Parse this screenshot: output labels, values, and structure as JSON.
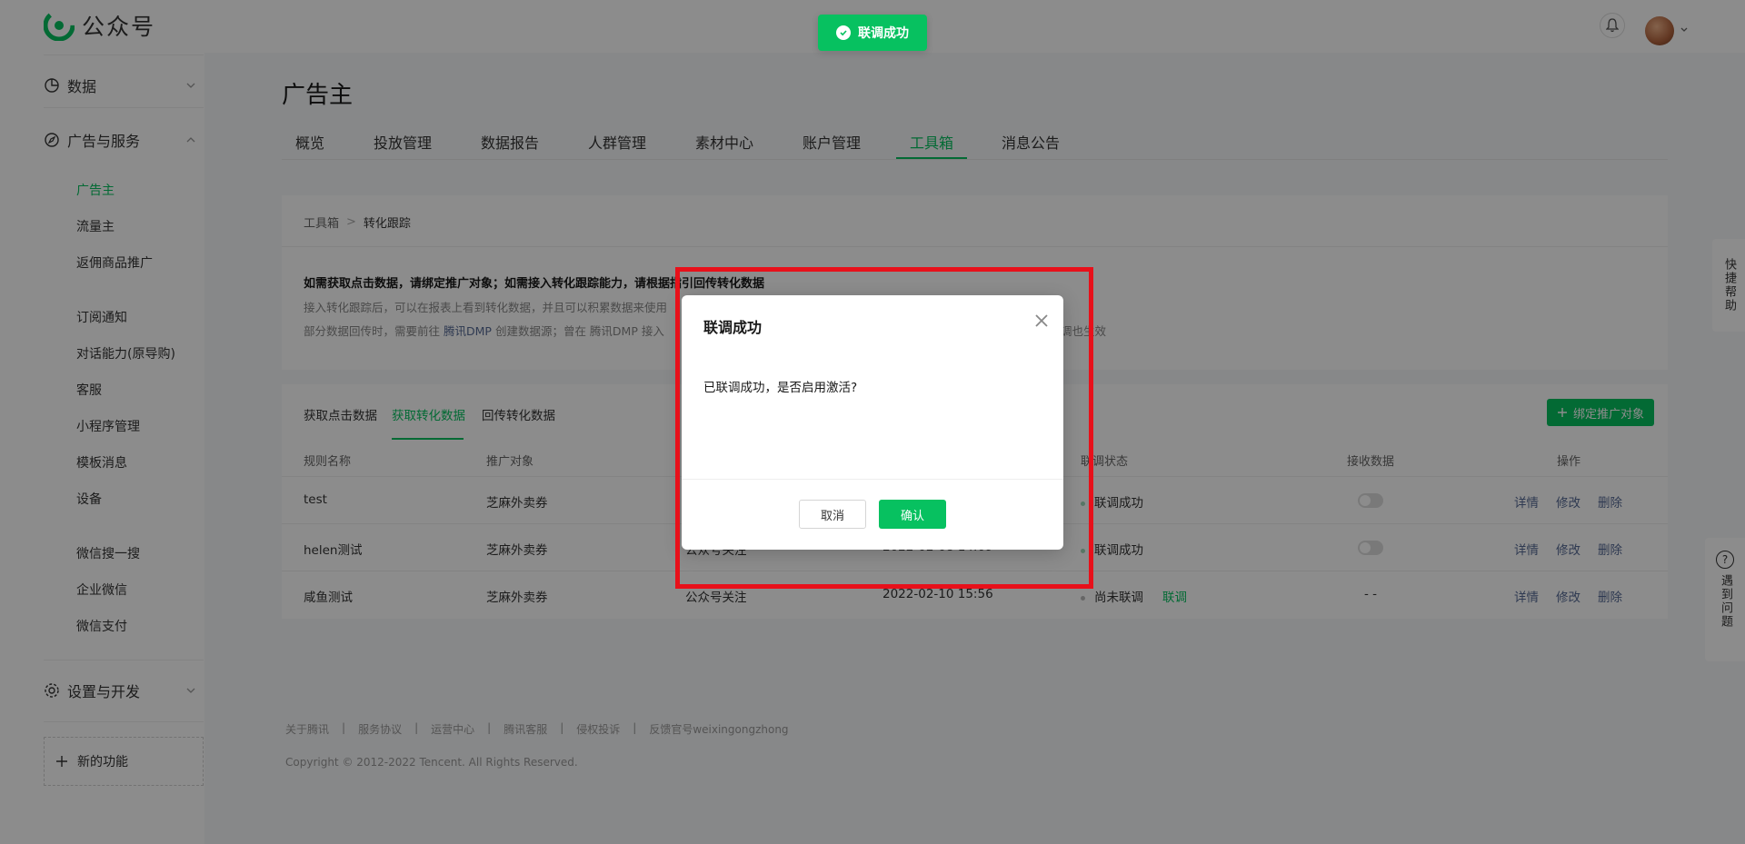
{
  "app": {
    "name": "公众号"
  },
  "sidebar": {
    "groups": [
      {
        "label": "数据"
      },
      {
        "label": "广告与服务"
      },
      {
        "label": "设置与开发"
      }
    ],
    "items": [
      {
        "label": "广告主",
        "active": true
      },
      {
        "label": "流量主"
      },
      {
        "label": "返佣商品推广"
      },
      {
        "label": "订阅通知"
      },
      {
        "label": "对话能力(原导购)"
      },
      {
        "label": "客服"
      },
      {
        "label": "小程序管理"
      },
      {
        "label": "模板消息"
      },
      {
        "label": "设备"
      },
      {
        "label": "微信搜一搜"
      },
      {
        "label": "企业微信"
      },
      {
        "label": "微信支付"
      }
    ],
    "new_func": "新的功能"
  },
  "page": {
    "title": "广告主"
  },
  "tabs": [
    {
      "label": "概览"
    },
    {
      "label": "投放管理"
    },
    {
      "label": "数据报告"
    },
    {
      "label": "人群管理"
    },
    {
      "label": "素材中心"
    },
    {
      "label": "账户管理"
    },
    {
      "label": "工具箱",
      "active": true
    },
    {
      "label": "消息公告"
    }
  ],
  "breadcrumb": {
    "parent": "工具箱",
    "sep": ">",
    "current": "转化跟踪"
  },
  "notice": {
    "title": "如需获取点击数据，请绑定推广对象；如需接入转化跟踪能力，请根据指引回传转化数据",
    "line1": "接入转化跟踪后，可以在报表上看到转化数据，并且可以积累数据来使用",
    "line2_a": "部分数据回传时，需要前往",
    "line2_link": "腾讯DMP",
    "line2_b": "创建数据源；曾在 腾讯DMP 接入",
    "line2_tail": "调也生效"
  },
  "subtabs": [
    {
      "label": "获取点击数据"
    },
    {
      "label": "获取转化数据",
      "active": true
    },
    {
      "label": "回传转化数据"
    }
  ],
  "bind_button": "绑定推广对象",
  "table": {
    "headers": [
      "规则名称",
      "推广对象",
      "联调状态",
      "接收数据",
      "操作"
    ],
    "rows": [
      {
        "name": "test",
        "target": "芝麻外卖券",
        "type": "",
        "time": "",
        "status": "联调成功",
        "receive": "toggle"
      },
      {
        "name": "helen测试",
        "target": "芝麻外卖券",
        "type": "公众号关注",
        "time": "2022-02-08 14:09",
        "status": "联调成功",
        "receive": "toggle"
      },
      {
        "name": "咸鱼测试",
        "target": "芝麻外卖券",
        "type": "公众号关注",
        "time": "2022-02-10 15:56",
        "status": "尚未联调",
        "action_link": "联调",
        "receive": "- -"
      }
    ],
    "ops": [
      "详情",
      "修改",
      "删除"
    ]
  },
  "footer": {
    "links": [
      "关于腾讯",
      "服务协议",
      "运营中心",
      "腾讯客服",
      "侵权投诉",
      "反馈官号weixingongzhong"
    ],
    "separator": "|",
    "copyright": "Copyright © 2012-2022 Tencent. All Rights Reserved."
  },
  "float_help": {
    "quick": "快捷帮助",
    "problem": "遇到问题"
  },
  "toast": {
    "text": "联调成功"
  },
  "dialog": {
    "title": "联调成功",
    "body": "已联调成功，是否启用激活?",
    "cancel": "取消",
    "confirm": "确认"
  },
  "colors": {
    "brand": "#07c160",
    "highlight": "#e8101a",
    "link": "#576b95"
  }
}
